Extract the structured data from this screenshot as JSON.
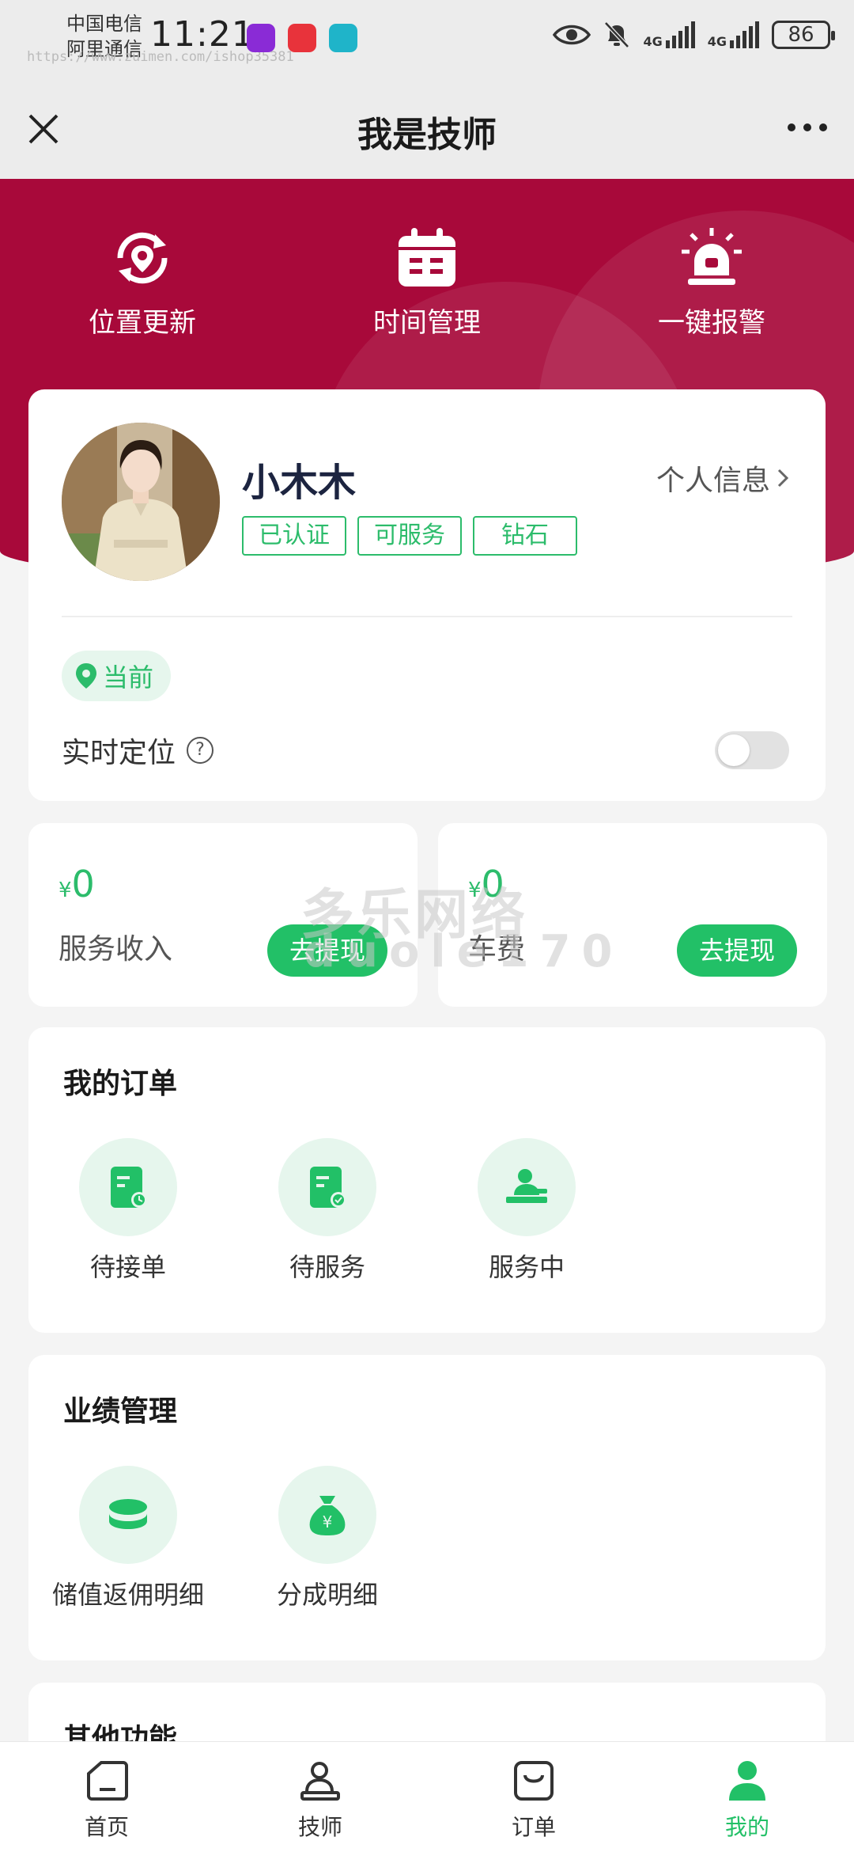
{
  "status_bar": {
    "carrier_1": "中国电信",
    "carrier_2": "阿里通信",
    "time": "11:21",
    "network_1": "4G",
    "network_2": "4G",
    "battery": "86"
  },
  "watermark_url": "https://www.zuimen.com/ishop35381",
  "nav": {
    "title": "我是技师"
  },
  "quick_actions": [
    {
      "label": "位置更新",
      "icon": "location-refresh-icon"
    },
    {
      "label": "时间管理",
      "icon": "calendar-icon"
    },
    {
      "label": "一键报警",
      "icon": "alarm-icon"
    }
  ],
  "profile": {
    "name": "小木木",
    "info_link": "个人信息",
    "tags": [
      "已认证",
      "可服务",
      "钻石"
    ],
    "location_chip": "当前",
    "realtime_label": "实时定位",
    "realtime_enabled": false
  },
  "income": {
    "currency": "¥",
    "service": {
      "amount": "0",
      "label": "服务收入",
      "button": "去提现"
    },
    "fare": {
      "amount": "0",
      "label": "车费",
      "button": "去提现"
    }
  },
  "watermark": {
    "line1": "多乐网络",
    "line2": "duole170"
  },
  "orders": {
    "title": "我的订单",
    "items": [
      "待接单",
      "待服务",
      "服务中"
    ]
  },
  "performance": {
    "title": "业绩管理",
    "items": [
      "储值返佣明细",
      "分成明细"
    ]
  },
  "other": {
    "title": "其他功能"
  },
  "tabbar": {
    "items": [
      "首页",
      "技师",
      "订单",
      "我的"
    ],
    "active": "我的"
  },
  "colors": {
    "brand": "#a8093a",
    "accent": "#22c067",
    "accent_light": "#e6f6ed"
  }
}
